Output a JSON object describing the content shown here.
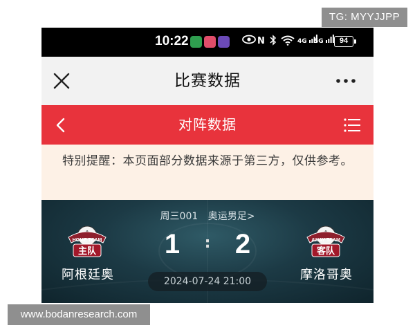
{
  "watermarks": {
    "top": "TG: MYYJJPP",
    "bottom": "www.bodanresearch.com"
  },
  "status_bar": {
    "time": "10:22",
    "battery": "94",
    "network_4g": "4G",
    "network_5g": "5G",
    "nfc": "N"
  },
  "title_bar": {
    "title": "比赛数据",
    "close_icon": "close-icon",
    "more_icon": "more-icon"
  },
  "sub_header": {
    "title": "对阵数据",
    "back_icon": "chevron-left-icon",
    "menu_icon": "list-menu-icon",
    "color": "#e8333c"
  },
  "notice": {
    "text": "特别提醒：本页面部分数据来源于第三方，仅供参考。",
    "background": "#fdf1e6"
  },
  "match": {
    "match_code": "周三001",
    "league_link": "奥运男足>",
    "home": {
      "badge_top": "HOME TEAM",
      "badge_main": "主队",
      "name": "阿根廷奥",
      "score": "1"
    },
    "away": {
      "badge_top": "AWAY TEAM",
      "badge_main": "客队",
      "name": "摩洛哥奥",
      "score": "2"
    },
    "separator": ":",
    "datetime": "2024-07-24 21:00"
  }
}
